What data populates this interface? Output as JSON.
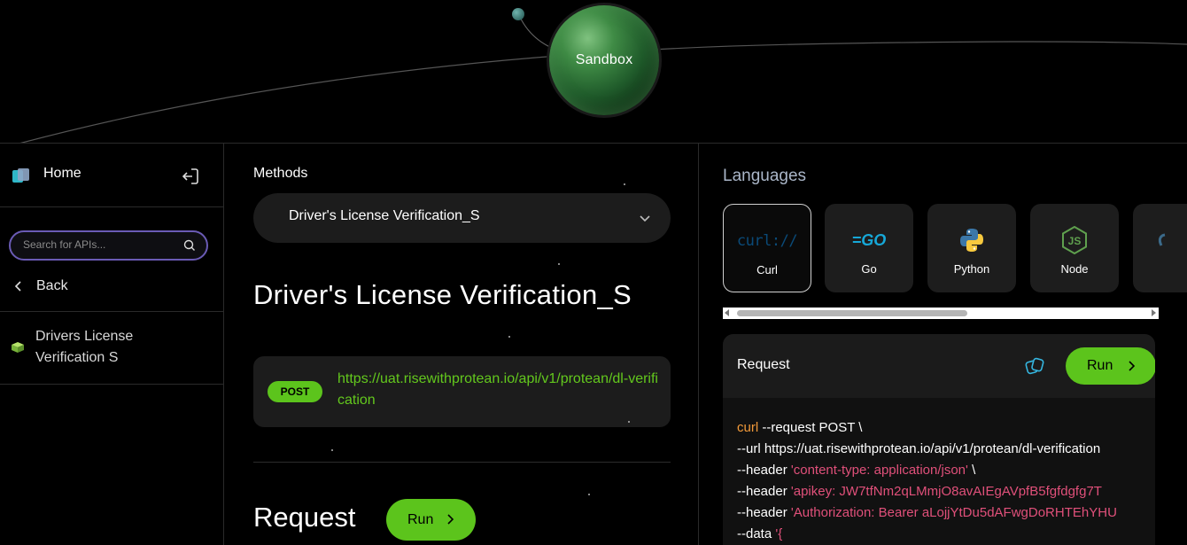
{
  "header": {
    "planet_label": "Sandbox"
  },
  "sidebar": {
    "home_label": "Home",
    "search_placeholder": "Search for APIs...",
    "back_label": "Back",
    "api_items": [
      {
        "label": "Drivers License Verification S"
      }
    ]
  },
  "methods": {
    "title": "Methods",
    "selected": "Driver's License Verification_S",
    "heading": "Driver's License Verification_S",
    "endpoint": {
      "method": "POST",
      "url": "https://uat.risewithprotean.io/api/v1/protean/dl-verification"
    },
    "request_heading": "Request",
    "run_label": "Run"
  },
  "languages": {
    "title": "Languages",
    "items": [
      {
        "label": "Curl",
        "icon": "curl-icon",
        "active": true
      },
      {
        "label": "Go",
        "icon": "go-icon"
      },
      {
        "label": "Python",
        "icon": "python-icon"
      },
      {
        "label": "Node",
        "icon": "node-icon"
      }
    ]
  },
  "request": {
    "label": "Request",
    "run_label": "Run",
    "code": {
      "line1_kw": "curl",
      "line1_rest": " --request POST \\",
      "line2": "--url https://uat.risewithprotean.io/api/v1/protean/dl-verification",
      "line3_pre": "--header ",
      "line3_str": "'content-type: application/json'",
      "line3_post": " \\",
      "line4_pre": "--header ",
      "line4_str": "'apikey: JW7tfNm2qLMmjO8avAIEgAVpfB5fgfdgfg7T",
      "line5_pre": "--header ",
      "line5_str": "'Authorization: Bearer aLojjYtDu5dAFwgDoRHTEhYHU",
      "line6_pre": "--data ",
      "line6_str": "'{"
    }
  },
  "colors": {
    "accent_green": "#5cc41c",
    "url_green": "#63c81d",
    "search_border": "#6a5bb5"
  }
}
